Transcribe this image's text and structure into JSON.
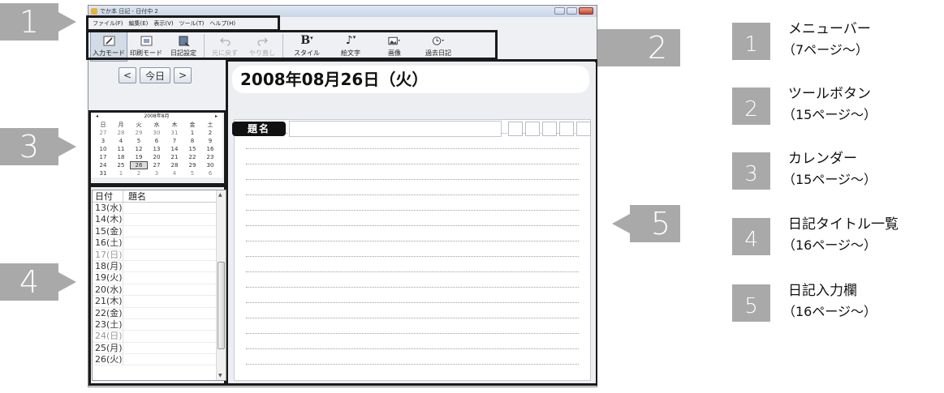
{
  "app": {
    "window_title": "でか本 日記 - 日付中 2",
    "window_controls": [
      "minimize",
      "maximize",
      "close"
    ]
  },
  "menubar": {
    "items": [
      "ファイル(F)",
      "編集(E)",
      "表示(V)",
      "ツール(T)",
      "ヘルプ(H)"
    ]
  },
  "toolbar": {
    "tools": [
      {
        "label": "入力モード",
        "icon": "pencil-icon",
        "state": "pressed"
      },
      {
        "label": "印刷モード",
        "icon": "print-mode-icon",
        "state": "normal"
      },
      {
        "label": "日記設定",
        "icon": "diary-settings-icon",
        "state": "normal"
      },
      {
        "label": "元に戻す",
        "icon": "undo-icon",
        "state": "disabled"
      },
      {
        "label": "やり直し",
        "icon": "redo-icon",
        "state": "disabled"
      },
      {
        "label": "スタイル",
        "icon": "bold-b-icon",
        "state": "normal"
      },
      {
        "label": "絵文字",
        "icon": "music-note-icon",
        "state": "normal"
      },
      {
        "label": "画像",
        "icon": "image-icon",
        "state": "normal"
      },
      {
        "label": "過去日記",
        "icon": "clock-icon",
        "state": "normal"
      }
    ]
  },
  "nav": {
    "prev": "<",
    "today": "今日",
    "next": ">"
  },
  "calendar": {
    "month_label": "2008年8月",
    "weekdays": [
      "日",
      "月",
      "火",
      "水",
      "木",
      "金",
      "土"
    ],
    "weeks": [
      [
        "27",
        "28",
        "29",
        "30",
        "31",
        "1",
        "2"
      ],
      [
        "3",
        "4",
        "5",
        "6",
        "7",
        "8",
        "9"
      ],
      [
        "10",
        "11",
        "12",
        "13",
        "14",
        "15",
        "16"
      ],
      [
        "17",
        "18",
        "19",
        "20",
        "21",
        "22",
        "23"
      ],
      [
        "24",
        "25",
        "26",
        "27",
        "28",
        "29",
        "30"
      ],
      [
        "31",
        "1",
        "2",
        "3",
        "4",
        "5",
        "6"
      ]
    ],
    "selected": "26"
  },
  "title_list": {
    "headers": [
      "日付",
      "題名"
    ],
    "rows": [
      {
        "date": "13(水)",
        "weekend": false
      },
      {
        "date": "14(木)",
        "weekend": false
      },
      {
        "date": "15(金)",
        "weekend": false
      },
      {
        "date": "16(土)",
        "weekend": false
      },
      {
        "date": "17(日)",
        "weekend": true
      },
      {
        "date": "18(月)",
        "weekend": false
      },
      {
        "date": "19(火)",
        "weekend": false
      },
      {
        "date": "20(水)",
        "weekend": false
      },
      {
        "date": "21(木)",
        "weekend": false
      },
      {
        "date": "22(金)",
        "weekend": false
      },
      {
        "date": "23(土)",
        "weekend": false
      },
      {
        "date": "24(日)",
        "weekend": true
      },
      {
        "date": "25(月)",
        "weekend": false
      },
      {
        "date": "26(火)",
        "weekend": false
      }
    ]
  },
  "diary": {
    "date_banner": "2008年08月26日（火）",
    "title_label": "題名",
    "title_value": "",
    "ruled_line_count": 16
  },
  "callouts": {
    "c1": "1",
    "c2": "2",
    "c3": "3",
    "c4": "4",
    "c5": "5"
  },
  "legend": [
    {
      "num": "1",
      "title": "メニューバー",
      "page": "（7ページ〜）"
    },
    {
      "num": "2",
      "title": "ツールボタン",
      "page": "（15ページ〜）"
    },
    {
      "num": "3",
      "title": "カレンダー",
      "page": "（15ページ〜）"
    },
    {
      "num": "4",
      "title": "日記タイトル一覧",
      "page": "（16ページ〜）"
    },
    {
      "num": "5",
      "title": "日記入力欄",
      "page": "（16ページ〜）"
    }
  ],
  "colors": {
    "callout_gray": "#a9a9a9",
    "highlight_border": "#1a1a1a",
    "window_bg": "#eef0f4"
  }
}
